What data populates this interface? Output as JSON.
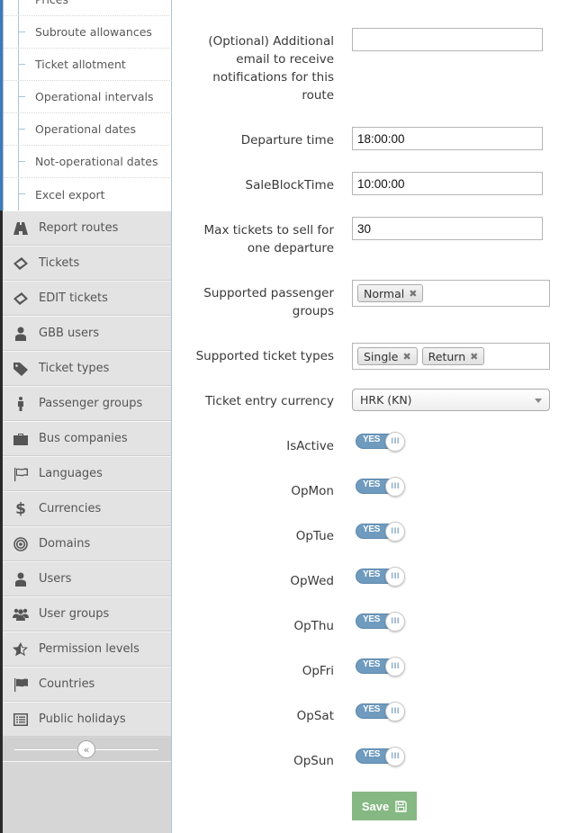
{
  "sidebar": {
    "submenu": [
      {
        "label": "Prices"
      },
      {
        "label": "Subroute allowances"
      },
      {
        "label": "Ticket allotment"
      },
      {
        "label": "Operational intervals"
      },
      {
        "label": "Operational dates"
      },
      {
        "label": "Not-operational dates"
      },
      {
        "label": "Excel export"
      }
    ],
    "items": [
      {
        "label": "Report routes",
        "icon": "road-icon"
      },
      {
        "label": "Tickets",
        "icon": "ticket-icon"
      },
      {
        "label": "EDIT tickets",
        "icon": "ticket-icon"
      },
      {
        "label": "GBB users",
        "icon": "user-md-icon"
      },
      {
        "label": "Ticket types",
        "icon": "tags-icon"
      },
      {
        "label": "Passenger groups",
        "icon": "male-icon"
      },
      {
        "label": "Bus companies",
        "icon": "briefcase-icon"
      },
      {
        "label": "Languages",
        "icon": "flag-outline-icon"
      },
      {
        "label": "Currencies",
        "icon": "dollar-icon"
      },
      {
        "label": "Domains",
        "icon": "bullseye-icon"
      },
      {
        "label": "Users",
        "icon": "user-md-icon"
      },
      {
        "label": "User groups",
        "icon": "group-icon"
      },
      {
        "label": "Permission levels",
        "icon": "star-half-icon"
      },
      {
        "label": "Countries",
        "icon": "flag-icon"
      },
      {
        "label": "Public holidays",
        "icon": "list-alt-icon"
      }
    ],
    "collapse_glyph": "«"
  },
  "form": {
    "top_label_fragment": "route",
    "additional_email": {
      "label": "(Optional) Additional email to receive notifications for this route",
      "value": ""
    },
    "departure_time": {
      "label": "Departure time",
      "value": "18:00:00"
    },
    "sale_block_time": {
      "label": "SaleBlockTime",
      "value": "10:00:00"
    },
    "max_tickets": {
      "label": "Max tickets to sell for one departure",
      "value": "30"
    },
    "passenger_groups": {
      "label": "Supported passenger groups",
      "tags": [
        "Normal"
      ]
    },
    "ticket_types": {
      "label": "Supported ticket types",
      "tags": [
        "Single",
        "Return"
      ]
    },
    "currency": {
      "label": "Ticket entry currency",
      "selected": "HRK (KN)"
    },
    "switches": [
      {
        "label": "IsActive",
        "state": "YES"
      },
      {
        "label": "OpMon",
        "state": "YES"
      },
      {
        "label": "OpTue",
        "state": "YES"
      },
      {
        "label": "OpWed",
        "state": "YES"
      },
      {
        "label": "OpThu",
        "state": "YES"
      },
      {
        "label": "OpFri",
        "state": "YES"
      },
      {
        "label": "OpSat",
        "state": "YES"
      },
      {
        "label": "OpSun",
        "state": "YES"
      }
    ],
    "tag_remove_glyph": "✖",
    "save_label": "Save"
  },
  "colors": {
    "switch_on": "#6f9bbf",
    "save_button": "#86b883",
    "sidebar_bg": "#e3e3e3",
    "accent_border": "#a9c3da"
  }
}
